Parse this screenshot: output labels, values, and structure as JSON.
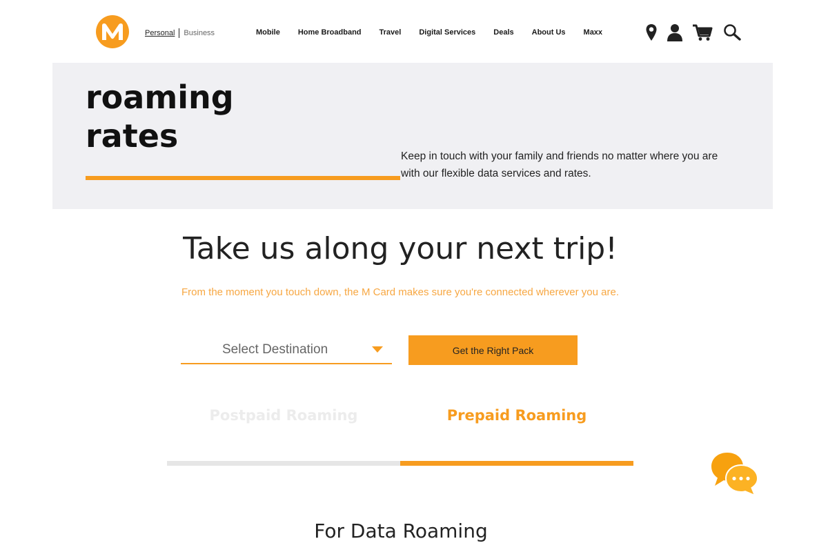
{
  "header": {
    "logo_icon": "m-logo-icon",
    "segments": {
      "personal": "Personal",
      "business": "Business"
    },
    "nav": [
      {
        "label": "Mobile"
      },
      {
        "label": "Home Broadband"
      },
      {
        "label": "Travel"
      },
      {
        "label": "Digital Services"
      },
      {
        "label": "Deals"
      },
      {
        "label": "About Us"
      },
      {
        "label": "Maxx"
      }
    ],
    "icons": [
      "location-pin-icon",
      "user-icon",
      "cart-icon",
      "search-icon"
    ]
  },
  "hero": {
    "title_line1": "roaming",
    "title_line2": "rates",
    "description": "Keep in touch with your family and friends no matter where you are with our flexible data services and rates."
  },
  "main": {
    "heading": "Take us along your next trip!",
    "subheading": "From the moment you touch down, the M Card makes sure you're connected wherever you are.",
    "destination_placeholder": "Select Destination",
    "cta_label": "Get the Right Pack"
  },
  "tabs": [
    {
      "label": "Postpaid Roaming",
      "active": false
    },
    {
      "label": "Prepaid Roaming",
      "active": true
    }
  ],
  "section": {
    "heading": "For Data Roaming"
  },
  "colors": {
    "accent": "#f79c1f",
    "accent_light": "#f7a742",
    "hero_bg": "#f0f0f3",
    "text_dark": "#222222",
    "tab_inactive": "#ececec"
  }
}
